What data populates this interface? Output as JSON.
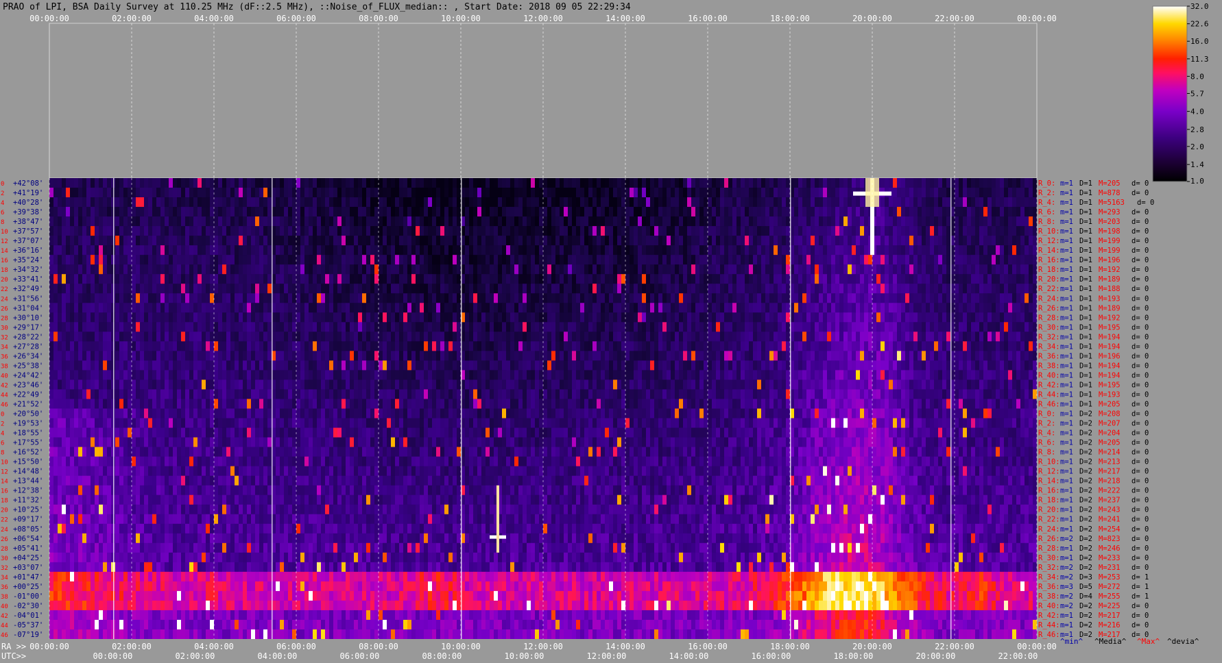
{
  "title": "PRAO of LPI, BSA Daily Survey at 110.25 MHz (dF::2.5 MHz), ::Noise_of_FLUX_median:: , Start Date: 2018 09 05 22:29:34",
  "chart_data": {
    "type": "heatmap",
    "title": "PRAO of LPI, BSA Daily Survey at 110.25 MHz (dF::2.5 MHz), ::Noise_of_FLUX_median:: , Start Date: 2018 09 05 22:29:34",
    "top_time_ticks": [
      "00:00:00",
      "02:00:00",
      "04:00:00",
      "06:00:00",
      "08:00:00",
      "10:00:00",
      "12:00:00",
      "14:00:00",
      "16:00:00",
      "18:00:00",
      "20:00:00",
      "22:00:00",
      "00:00:00"
    ],
    "bottom_ra_label": "RA >>",
    "bottom_ra_ticks": [
      "00:00:00",
      "02:00:00",
      "04:00:00",
      "06:00:00",
      "08:00:00",
      "10:00:00",
      "12:00:00",
      "14:00:00",
      "16:00:00",
      "18:00:00",
      "20:00:00",
      "22:00:00",
      "00:00:00"
    ],
    "bottom_utc_label": "UTC>>",
    "bottom_utc_ticks": [
      "00:00:00",
      "02:00:00",
      "04:00:00",
      "06:00:00",
      "08:00:00",
      "10:00:00",
      "12:00:00",
      "14:00:00",
      "16:00:00",
      "18:00:00",
      "20:00:00",
      "22:00:00"
    ],
    "declinations": [
      "+42°08'",
      "+41°19'",
      "+40°28'",
      "+39°38'",
      "+38°47'",
      "+37°57'",
      "+37°07'",
      "+36°16'",
      "+35°24'",
      "+34°32'",
      "+33°41'",
      "+32°49'",
      "+31°56'",
      "+31°04'",
      "+30°10'",
      "+29°17'",
      "+28°22'",
      "+27°28'",
      "+26°34'",
      "+25°38'",
      "+24°42'",
      "+23°46'",
      "+22°49'",
      "+21°52'",
      "+20°50'",
      "+19°53'",
      "+18°55'",
      "+17°55'",
      "+16°52'",
      "+15°50'",
      "+14°48'",
      "+13°44'",
      "+12°38'",
      "+11°32'",
      "+10°25'",
      "+09°17'",
      "+08°05'",
      "+06°54'",
      "+05°41'",
      "+04°25'",
      "+03°07'",
      "+01°47'",
      "+00°25'",
      "-01°00'",
      "-02°30'",
      "-04°01'",
      "-05°37'",
      "-07°19'"
    ],
    "beam_numbers": [
      "0",
      "2",
      "4",
      "6",
      "8",
      "10",
      "12",
      "14",
      "16",
      "18",
      "20",
      "22",
      "24",
      "26",
      "28",
      "30",
      "32",
      "34",
      "36",
      "38",
      "40",
      "42",
      "44",
      "46",
      "0",
      "2",
      "4",
      "6",
      "8",
      "10",
      "12",
      "14",
      "16",
      "18",
      "20",
      "22",
      "24",
      "26",
      "28",
      "30",
      "32",
      "34",
      "36",
      "38",
      "40",
      "42",
      "44",
      "46"
    ],
    "row_stats": [
      {
        "r": "R_0:",
        "m": "m=1",
        "d": "D=1",
        "M": "M=205",
        "dev": "d= 0"
      },
      {
        "r": "R_2:",
        "m": "m=1",
        "d": "D=1",
        "M": "M=878",
        "dev": "d= 0"
      },
      {
        "r": "R_4:",
        "m": "m=1",
        "d": "D=1",
        "M": "M=5163",
        "dev": "d= 0"
      },
      {
        "r": "R_6:",
        "m": "m=1",
        "d": "D=1",
        "M": "M=293",
        "dev": "d= 0"
      },
      {
        "r": "R_8:",
        "m": "m=1",
        "d": "D=1",
        "M": "M=203",
        "dev": "d= 0"
      },
      {
        "r": "R_10:",
        "m": "m=1",
        "d": "D=1",
        "M": "M=198",
        "dev": "d= 0"
      },
      {
        "r": "R_12:",
        "m": "m=1",
        "d": "D=1",
        "M": "M=199",
        "dev": "d= 0"
      },
      {
        "r": "R_14:",
        "m": "m=1",
        "d": "D=1",
        "M": "M=199",
        "dev": "d= 0"
      },
      {
        "r": "R_16:",
        "m": "m=1",
        "d": "D=1",
        "M": "M=196",
        "dev": "d= 0"
      },
      {
        "r": "R_18:",
        "m": "m=1",
        "d": "D=1",
        "M": "M=192",
        "dev": "d= 0"
      },
      {
        "r": "R_20:",
        "m": "m=1",
        "d": "D=1",
        "M": "M=189",
        "dev": "d= 0"
      },
      {
        "r": "R_22:",
        "m": "m=1",
        "d": "D=1",
        "M": "M=188",
        "dev": "d= 0"
      },
      {
        "r": "R_24:",
        "m": "m=1",
        "d": "D=1",
        "M": "M=193",
        "dev": "d= 0"
      },
      {
        "r": "R_26:",
        "m": "m=1",
        "d": "D=1",
        "M": "M=189",
        "dev": "d= 0"
      },
      {
        "r": "R_28:",
        "m": "m=1",
        "d": "D=1",
        "M": "M=192",
        "dev": "d= 0"
      },
      {
        "r": "R_30:",
        "m": "m=1",
        "d": "D=1",
        "M": "M=195",
        "dev": "d= 0"
      },
      {
        "r": "R_32:",
        "m": "m=1",
        "d": "D=1",
        "M": "M=194",
        "dev": "d= 0"
      },
      {
        "r": "R_34:",
        "m": "m=1",
        "d": "D=1",
        "M": "M=194",
        "dev": "d= 0"
      },
      {
        "r": "R_36:",
        "m": "m=1",
        "d": "D=1",
        "M": "M=196",
        "dev": "d= 0"
      },
      {
        "r": "R_38:",
        "m": "m=1",
        "d": "D=1",
        "M": "M=194",
        "dev": "d= 0"
      },
      {
        "r": "R_40:",
        "m": "m=1",
        "d": "D=1",
        "M": "M=194",
        "dev": "d= 0"
      },
      {
        "r": "R_42:",
        "m": "m=1",
        "d": "D=1",
        "M": "M=195",
        "dev": "d= 0"
      },
      {
        "r": "R_44:",
        "m": "m=1",
        "d": "D=1",
        "M": "M=193",
        "dev": "d= 0"
      },
      {
        "r": "R_46:",
        "m": "m=1",
        "d": "D=1",
        "M": "M=205",
        "dev": "d= 0"
      },
      {
        "r": "R_0:",
        "m": "m=1",
        "d": "D=2",
        "M": "M=208",
        "dev": "d= 0"
      },
      {
        "r": "R_2:",
        "m": "m=1",
        "d": "D=2",
        "M": "M=207",
        "dev": "d= 0"
      },
      {
        "r": "R_4:",
        "m": "m=1",
        "d": "D=2",
        "M": "M=204",
        "dev": "d= 0"
      },
      {
        "r": "R_6:",
        "m": "m=1",
        "d": "D=2",
        "M": "M=205",
        "dev": "d= 0"
      },
      {
        "r": "R_8:",
        "m": "m=1",
        "d": "D=2",
        "M": "M=214",
        "dev": "d= 0"
      },
      {
        "r": "R_10:",
        "m": "m=1",
        "d": "D=2",
        "M": "M=213",
        "dev": "d= 0"
      },
      {
        "r": "R_12:",
        "m": "m=1",
        "d": "D=2",
        "M": "M=217",
        "dev": "d= 0"
      },
      {
        "r": "R_14:",
        "m": "m=1",
        "d": "D=2",
        "M": "M=218",
        "dev": "d= 0"
      },
      {
        "r": "R_16:",
        "m": "m=1",
        "d": "D=2",
        "M": "M=222",
        "dev": "d= 0"
      },
      {
        "r": "R_18:",
        "m": "m=1",
        "d": "D=2",
        "M": "M=237",
        "dev": "d= 0"
      },
      {
        "r": "R_20:",
        "m": "m=1",
        "d": "D=2",
        "M": "M=243",
        "dev": "d= 0"
      },
      {
        "r": "R_22:",
        "m": "m=1",
        "d": "D=2",
        "M": "M=241",
        "dev": "d= 0"
      },
      {
        "r": "R_24:",
        "m": "m=1",
        "d": "D=2",
        "M": "M=254",
        "dev": "d= 0"
      },
      {
        "r": "R_26:",
        "m": "m=2",
        "d": "D=2",
        "M": "M=823",
        "dev": "d= 0"
      },
      {
        "r": "R_28:",
        "m": "m=1",
        "d": "D=2",
        "M": "M=246",
        "dev": "d= 0"
      },
      {
        "r": "R_30:",
        "m": "m=1",
        "d": "D=2",
        "M": "M=233",
        "dev": "d= 0"
      },
      {
        "r": "R_32:",
        "m": "m=2",
        "d": "D=2",
        "M": "M=231",
        "dev": "d= 0"
      },
      {
        "r": "R_34:",
        "m": "m=2",
        "d": "D=3",
        "M": "M=253",
        "dev": "d= 1"
      },
      {
        "r": "R_36:",
        "m": "m=3",
        "d": "D=5",
        "M": "M=272",
        "dev": "d= 1"
      },
      {
        "r": "R_38:",
        "m": "m=2",
        "d": "D=4",
        "M": "M=255",
        "dev": "d= 1"
      },
      {
        "r": "R_40:",
        "m": "m=2",
        "d": "D=2",
        "M": "M=225",
        "dev": "d= 0"
      },
      {
        "r": "R_42:",
        "m": "m=1",
        "d": "D=2",
        "M": "M=217",
        "dev": "d= 0"
      },
      {
        "r": "R_44:",
        "m": "m=1",
        "d": "D=2",
        "M": "M=216",
        "dev": "d= 0"
      },
      {
        "r": "R_46:",
        "m": "m=1",
        "d": "D=2",
        "M": "M=217",
        "dev": "d= 0"
      }
    ],
    "stat_legend": [
      "^min^",
      "^Media^",
      "^Max^",
      "^devia^"
    ],
    "colorbar_ticks": [
      "32.0",
      "22.6",
      "16.0",
      "11.3",
      "8.0",
      "5.7",
      "4.0",
      "2.8",
      "2.0",
      "1.4",
      "1.0"
    ],
    "colorbar_scale": "log",
    "colorbar_range": [
      1.0,
      32.0
    ],
    "features": [
      {
        "ra_hours": 20.0,
        "dec": "+42°08' to +34°32'",
        "description": "strong vertical source streak"
      },
      {
        "ra_hours": 10.9,
        "dec": "+06°54'",
        "description": "bright point source"
      },
      {
        "ra_hours": 19.0,
        "dec": "+20°50' to -07°19'",
        "description": "bright diffuse emission band"
      },
      {
        "dec": "+01°47' to -01°00'",
        "description": "horizontal interference band across all hours"
      }
    ]
  },
  "colors": {
    "background": "#999999",
    "title_text": "#000000",
    "dec_text": "#000080",
    "beam_text": "#ff0000",
    "stat_r": "#ff0000",
    "stat_m": "#0000aa",
    "stat_d": "#000000",
    "stat_M": "#ff0000",
    "stat_dev": "#000000",
    "utc_text": "#ffffff",
    "time_text": "#ffffff"
  }
}
